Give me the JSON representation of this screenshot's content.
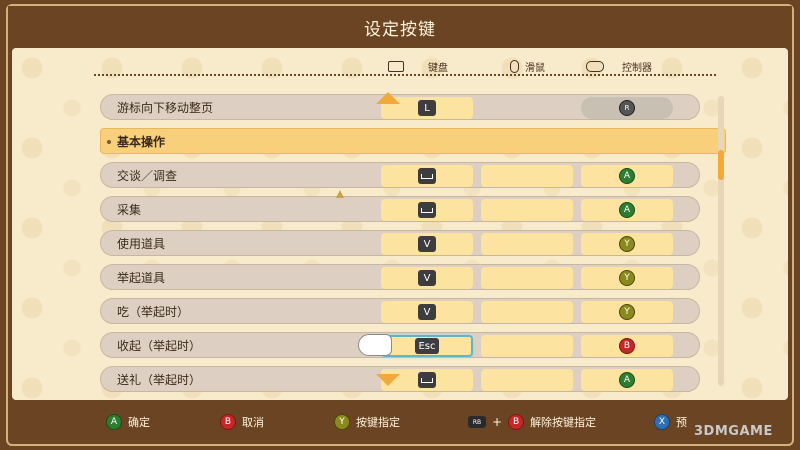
{
  "title": "设定按键",
  "columns": {
    "keyboard": {
      "label": "键盘",
      "icon": "keyboard-icon"
    },
    "mouse": {
      "label": "滑鼠",
      "icon": "mouse-icon"
    },
    "controller": {
      "label": "控制器",
      "icon": "controller-icon"
    }
  },
  "rows": [
    {
      "label": "游标向下移动整页",
      "key": "L",
      "mouse": "",
      "pad": "R",
      "pad_color": "r",
      "type": "action"
    },
    {
      "label": "基本操作",
      "type": "section"
    },
    {
      "label": "交谈／调查",
      "key": "␣",
      "mouse": "",
      "pad": "A",
      "pad_color": "a",
      "type": "action"
    },
    {
      "label": "采集",
      "key": "␣",
      "mouse": "",
      "pad": "A",
      "pad_color": "a",
      "type": "action"
    },
    {
      "label": "使用道具",
      "key": "V",
      "mouse": "",
      "pad": "Y",
      "pad_color": "y",
      "type": "action"
    },
    {
      "label": "举起道具",
      "key": "V",
      "mouse": "",
      "pad": "Y",
      "pad_color": "y",
      "type": "action"
    },
    {
      "label": "吃（举起时）",
      "key": "V",
      "mouse": "",
      "pad": "Y",
      "pad_color": "y",
      "type": "action"
    },
    {
      "label": "收起（举起时）",
      "key": "Esc",
      "mouse": "",
      "pad": "B",
      "pad_color": "b",
      "type": "action"
    },
    {
      "label": "送礼（举起时）",
      "key": "␣",
      "mouse": "",
      "pad": "A",
      "pad_color": "a",
      "type": "action"
    }
  ],
  "footer": {
    "confirm": {
      "btn": "A",
      "label": "确定"
    },
    "cancel": {
      "btn": "B",
      "label": "取消"
    },
    "assign": {
      "btn": "Y",
      "label": "按键指定"
    },
    "unassign": {
      "rb": "RB",
      "btn": "B",
      "label": "解除按键指定"
    },
    "preset": {
      "btn": "X",
      "label": "预"
    }
  },
  "watermark": "3DMGAME",
  "colors": {
    "accent": "#f2a93b",
    "section_bg": "#f8cf7a",
    "row_bg": "#ddd0c2",
    "cell_bg": "#fce3a0",
    "frame": "#6b4424",
    "panel": "#f7ebcc"
  }
}
